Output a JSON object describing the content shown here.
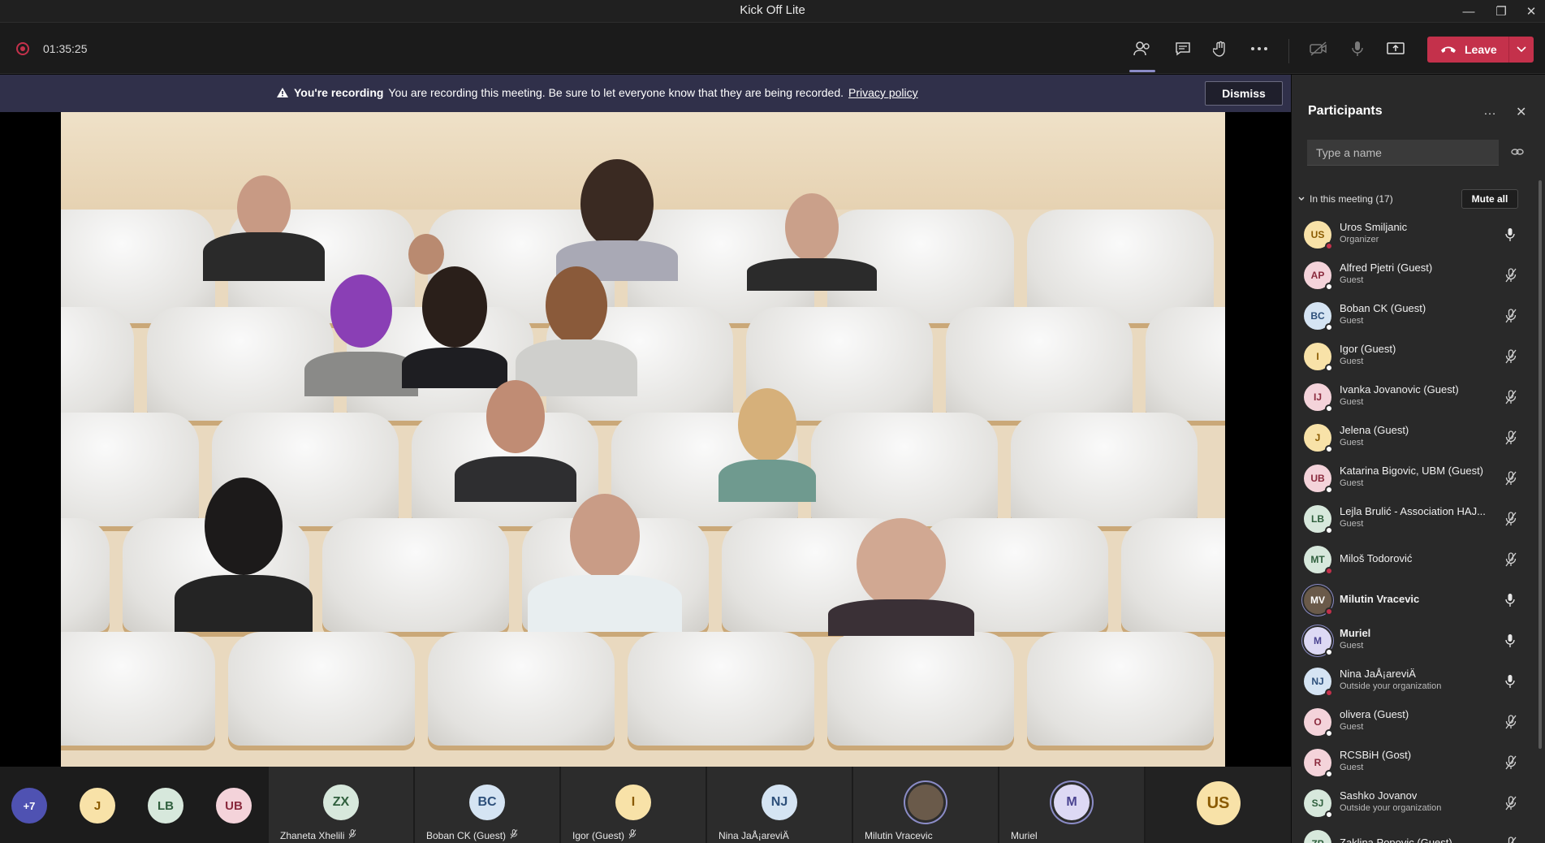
{
  "window": {
    "title": "Kick Off Lite"
  },
  "toolbar": {
    "timer": "01:35:25",
    "leave_label": "Leave"
  },
  "banner": {
    "heading": "You're recording",
    "message": "You are recording this meeting. Be sure to let everyone know that they are being recorded.",
    "link": "Privacy policy",
    "dismiss": "Dismiss"
  },
  "gallery": {
    "overflow": "+7",
    "small_avatars": [
      {
        "initials": "J",
        "color": "#f8e2a8",
        "text_color": "#8a5a00"
      },
      {
        "initials": "LB",
        "color": "#d7e8dc",
        "text_color": "#2f5f3d"
      },
      {
        "initials": "UB",
        "color": "#f4d3da",
        "text_color": "#8a2a3d"
      }
    ],
    "tiles": [
      {
        "initials": "ZX",
        "name": "Zhaneta Xhelili",
        "muted": true,
        "color": "#d7e8dc",
        "text_color": "#2f5f3d"
      },
      {
        "initials": "BC",
        "name": "Boban CK (Guest)",
        "muted": true,
        "color": "#d5e4f3",
        "text_color": "#2d4f7a"
      },
      {
        "initials": "I",
        "name": "Igor (Guest)",
        "muted": true,
        "color": "#f8e2a8",
        "text_color": "#8a5a00"
      },
      {
        "initials": "NJ",
        "name": "Nina JaÅ¡areviÄ",
        "muted": false,
        "color": "#d5e4f3",
        "text_color": "#2d4f7a"
      },
      {
        "initials": "",
        "name": "Milutin Vracevic",
        "muted": false,
        "color": "#6a5a4a",
        "text_color": "#ffffff"
      },
      {
        "initials": "M",
        "name": "Muriel",
        "muted": false,
        "color": "#ddd9f4",
        "text_color": "#4a4390"
      },
      {
        "initials": "US",
        "name": "",
        "muted": false,
        "color": "#f8e2a8",
        "text_color": "#8a5a00"
      }
    ]
  },
  "panel": {
    "title": "Participants",
    "search_placeholder": "Type a name",
    "section": "In this meeting (17)",
    "mute_all": "Mute all",
    "participants": [
      {
        "initials": "US",
        "name": "Uros Smiljanic",
        "role": "Organizer",
        "muted": false,
        "color": "#f8e2a8",
        "text_color": "#8a5a00",
        "status": "#c4314b"
      },
      {
        "initials": "AP",
        "name": "Alfred Pjetri (Guest)",
        "role": "Guest",
        "muted": true,
        "color": "#f4d3da",
        "text_color": "#8a2a3d",
        "status": "#ffffff"
      },
      {
        "initials": "BC",
        "name": "Boban CK (Guest)",
        "role": "Guest",
        "muted": true,
        "color": "#d5e4f3",
        "text_color": "#2d4f7a",
        "status": "#ffffff"
      },
      {
        "initials": "I",
        "name": "Igor (Guest)",
        "role": "Guest",
        "muted": true,
        "color": "#f8e2a8",
        "text_color": "#8a5a00",
        "status": "#ffffff"
      },
      {
        "initials": "IJ",
        "name": "Ivanka Jovanovic (Guest)",
        "role": "Guest",
        "muted": true,
        "color": "#f4d3da",
        "text_color": "#8a2a3d",
        "status": "#ffffff"
      },
      {
        "initials": "J",
        "name": "Jelena (Guest)",
        "role": "Guest",
        "muted": true,
        "color": "#f8e2a8",
        "text_color": "#8a5a00",
        "status": "#ffffff"
      },
      {
        "initials": "UB",
        "name": "Katarina Bigovic, UBM (Guest)",
        "role": "Guest",
        "muted": true,
        "color": "#f4d3da",
        "text_color": "#8a2a3d",
        "status": "#ffffff"
      },
      {
        "initials": "LB",
        "name": "Lejla Brulić - Association HAJ...",
        "role": "Guest",
        "muted": true,
        "color": "#d7e8dc",
        "text_color": "#2f5f3d",
        "status": "#ffffff"
      },
      {
        "initials": "MT",
        "name": "Miloš Todorović",
        "role": "",
        "muted": true,
        "color": "#d7e8dc",
        "text_color": "#2f5f3d",
        "status": "#c4314b"
      },
      {
        "initials": "MV",
        "name": "Milutin Vracevic",
        "role": "",
        "muted": false,
        "color": "#6a5a4a",
        "text_color": "#ffffff",
        "status": "#c4314b",
        "bold": true
      },
      {
        "initials": "M",
        "name": "Muriel",
        "role": "Guest",
        "muted": false,
        "color": "#ddd9f4",
        "text_color": "#4a4390",
        "status": "#ffffff",
        "bold": true
      },
      {
        "initials": "NJ",
        "name": "Nina JaÅ¡areviÄ",
        "role": "Outside your organization",
        "muted": false,
        "color": "#d5e4f3",
        "text_color": "#2d4f7a",
        "status": "#c4314b"
      },
      {
        "initials": "O",
        "name": "olivera (Guest)",
        "role": "Guest",
        "muted": true,
        "color": "#f4d3da",
        "text_color": "#8a2a3d",
        "status": "#ffffff"
      },
      {
        "initials": "R",
        "name": "RCSBiH (Gost)",
        "role": "Guest",
        "muted": true,
        "color": "#f4d3da",
        "text_color": "#8a2a3d",
        "status": "#ffffff"
      },
      {
        "initials": "SJ",
        "name": "Sashko Jovanov",
        "role": "Outside your organization",
        "muted": true,
        "color": "#d7e8dc",
        "text_color": "#2f5f3d",
        "status": "#ffffff"
      },
      {
        "initials": "ZP",
        "name": "Zaklina Popovic (Guest)",
        "role": "",
        "muted": true,
        "color": "#d7e8dc",
        "text_color": "#2f5f3d",
        "status": "#ffffff"
      }
    ]
  },
  "colors": {
    "accent": "#8b8cc7",
    "leave": "#c4314b",
    "banner": "#30304a",
    "panel": "#292929"
  }
}
